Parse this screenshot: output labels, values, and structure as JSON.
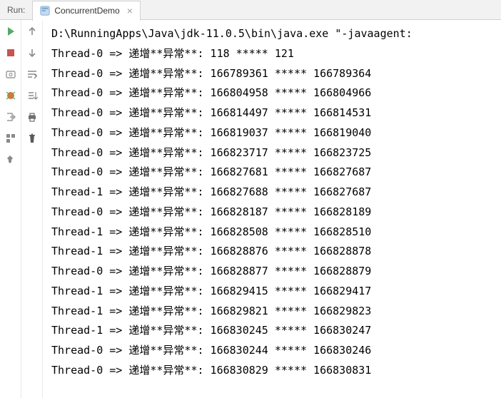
{
  "header": {
    "run_label": "Run:",
    "tab_name": "ConcurrentDemo",
    "close_glyph": "×"
  },
  "console": {
    "command": "D:\\RunningApps\\Java\\jdk-11.0.5\\bin\\java.exe \"-javaagent:",
    "lines": [
      {
        "thread": "Thread-0",
        "arrow": "=>",
        "msg": "递增**异常**:",
        "v1": "118",
        "sep": "*****",
        "v2": "121"
      },
      {
        "thread": "Thread-0",
        "arrow": "=>",
        "msg": "递增**异常**:",
        "v1": "166789361",
        "sep": "*****",
        "v2": "166789364"
      },
      {
        "thread": "Thread-0",
        "arrow": "=>",
        "msg": "递增**异常**:",
        "v1": "166804958",
        "sep": "*****",
        "v2": "166804966"
      },
      {
        "thread": "Thread-0",
        "arrow": "=>",
        "msg": "递增**异常**:",
        "v1": "166814497",
        "sep": "*****",
        "v2": "166814531"
      },
      {
        "thread": "Thread-0",
        "arrow": "=>",
        "msg": "递增**异常**:",
        "v1": "166819037",
        "sep": "*****",
        "v2": "166819040"
      },
      {
        "thread": "Thread-0",
        "arrow": "=>",
        "msg": "递增**异常**:",
        "v1": "166823717",
        "sep": "*****",
        "v2": "166823725"
      },
      {
        "thread": "Thread-0",
        "arrow": "=>",
        "msg": "递增**异常**:",
        "v1": "166827681",
        "sep": "*****",
        "v2": "166827687"
      },
      {
        "thread": "Thread-1",
        "arrow": "=>",
        "msg": "递增**异常**:",
        "v1": "166827688",
        "sep": "*****",
        "v2": "166827687"
      },
      {
        "thread": "Thread-0",
        "arrow": "=>",
        "msg": "递增**异常**:",
        "v1": "166828187",
        "sep": "*****",
        "v2": "166828189"
      },
      {
        "thread": "Thread-1",
        "arrow": "=>",
        "msg": "递增**异常**:",
        "v1": "166828508",
        "sep": "*****",
        "v2": "166828510"
      },
      {
        "thread": "Thread-1",
        "arrow": "=>",
        "msg": "递增**异常**:",
        "v1": "166828876",
        "sep": "*****",
        "v2": "166828878"
      },
      {
        "thread": "Thread-0",
        "arrow": "=>",
        "msg": "递增**异常**:",
        "v1": "166828877",
        "sep": "*****",
        "v2": "166828879"
      },
      {
        "thread": "Thread-1",
        "arrow": "=>",
        "msg": "递增**异常**:",
        "v1": "166829415",
        "sep": "*****",
        "v2": "166829417"
      },
      {
        "thread": "Thread-1",
        "arrow": "=>",
        "msg": "递增**异常**:",
        "v1": "166829821",
        "sep": "*****",
        "v2": "166829823"
      },
      {
        "thread": "Thread-1",
        "arrow": "=>",
        "msg": "递增**异常**:",
        "v1": "166830245",
        "sep": "*****",
        "v2": "166830247"
      },
      {
        "thread": "Thread-0",
        "arrow": "=>",
        "msg": "递增**异常**:",
        "v1": "166830244",
        "sep": "*****",
        "v2": "166830246"
      },
      {
        "thread": "Thread-0",
        "arrow": "=>",
        "msg": "递增**异常**:",
        "v1": "166830829",
        "sep": "*****",
        "v2": "166830831"
      }
    ]
  }
}
